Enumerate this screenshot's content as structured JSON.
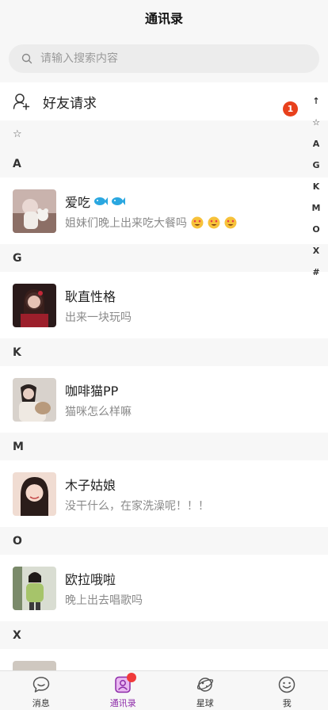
{
  "header": {
    "title": "通讯录"
  },
  "search": {
    "placeholder": "请输入搜索内容"
  },
  "friend_request": {
    "label": "好友请求",
    "badge": "1"
  },
  "star_header": "☆",
  "index_bar": [
    "↑",
    "☆",
    "A",
    "G",
    "K",
    "M",
    "O",
    "X",
    "#"
  ],
  "sections": [
    {
      "letter": "A",
      "contacts": [
        {
          "name": "爱吃",
          "message": "姐妹们晚上出来吃大餐吗"
        }
      ]
    },
    {
      "letter": "G",
      "contacts": [
        {
          "name": "耿直性格",
          "message": "出来一块玩吗"
        }
      ]
    },
    {
      "letter": "K",
      "contacts": [
        {
          "name": "咖啡猫PP",
          "message": "猫咪怎么样嘛"
        }
      ]
    },
    {
      "letter": "M",
      "contacts": [
        {
          "name": "木子姑娘",
          "message": "没干什么，在家洗澡呢！！！"
        }
      ]
    },
    {
      "letter": "O",
      "contacts": [
        {
          "name": "欧拉哦啦",
          "message": "晚上出去唱歌吗"
        }
      ]
    },
    {
      "letter": "X",
      "contacts": [
        {
          "name": "",
          "message": ""
        }
      ]
    }
  ],
  "tabbar": [
    {
      "label": "消息",
      "icon": "chat-bubble-icon"
    },
    {
      "label": "通讯录",
      "icon": "contacts-icon",
      "active": true
    },
    {
      "label": "星球",
      "icon": "planet-icon"
    },
    {
      "label": "我",
      "icon": "smile-icon"
    }
  ],
  "colors": {
    "accent": "#8d2aa8",
    "badge": "#e8401c",
    "background": "#f7f7f7"
  }
}
